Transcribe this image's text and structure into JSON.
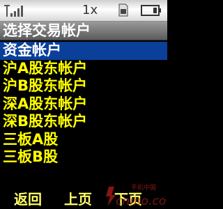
{
  "status_bar": {
    "signal_icon": "signal-strength-icon",
    "mode": "1x",
    "sim_icon": "sim-card-icon",
    "battery_icon": "battery-icon"
  },
  "title": "选择交易帐户",
  "menu": {
    "items": [
      {
        "label": "资金帐户",
        "selected": true
      },
      {
        "label": "沪A股东帐户",
        "selected": false
      },
      {
        "label": "沪B股东帐户",
        "selected": false
      },
      {
        "label": "深A股东帐户",
        "selected": false
      },
      {
        "label": "深B股东帐户",
        "selected": false
      },
      {
        "label": "三板A股",
        "selected": false
      },
      {
        "label": "三板B股",
        "selected": false
      }
    ]
  },
  "softkeys": {
    "back": "返回",
    "prev": "上页",
    "next": "下页"
  },
  "watermark": {
    "text_top": "手机中国",
    "text_bottom": "cnmo.com"
  },
  "colors": {
    "selected_bg": "#0a3f9a",
    "item_text": "#ffff00",
    "softkey_text": "#ffff66",
    "title_bg": "#7a7a7a"
  }
}
